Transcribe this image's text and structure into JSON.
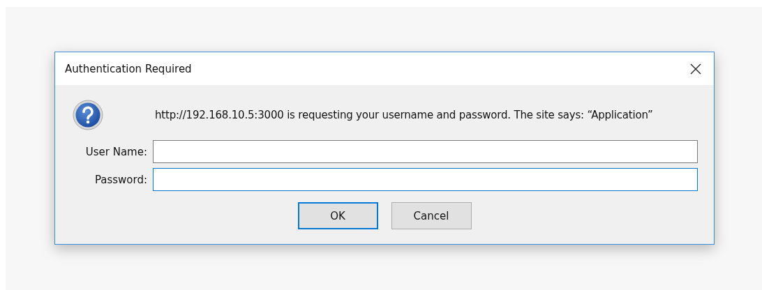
{
  "window": {
    "title": "Authentication Required"
  },
  "message": "http://192.168.10.5:3000 is requesting your username and password. The site says: “Application”",
  "fields": [
    {
      "label": "User Name:",
      "focused": false
    },
    {
      "label": "Password:",
      "focused": true
    }
  ],
  "buttons": [
    {
      "label": "OK",
      "default": true
    },
    {
      "label": "Cancel",
      "default": false
    }
  ]
}
